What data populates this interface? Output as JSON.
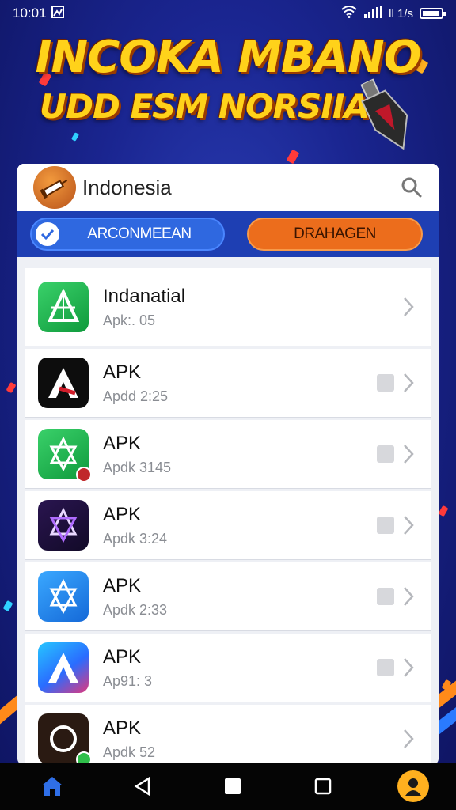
{
  "status_bar": {
    "time": "10:01",
    "notification_icon": "image-icon",
    "wifi_icon": "wifi-icon",
    "signal_icon": "signal-icon",
    "extra_text": "ll 1/s",
    "battery_icon": "battery-icon"
  },
  "banner": {
    "line1": "INCOKA MBANO",
    "line2": "UDD ESM NORSIIA"
  },
  "panel": {
    "logo_icon": "syringe-logo-icon",
    "title": "Indonesia",
    "search_icon": "search-icon"
  },
  "tabs": [
    {
      "label": "ARCONMEEAN",
      "icon": "check-circle-icon",
      "selected": true
    },
    {
      "label": "DRAHAGEN",
      "selected": false
    }
  ],
  "apps": [
    {
      "name": "Indanatial",
      "sub": "Apk:. 05",
      "icon": "green-a-icon"
    },
    {
      "name": "APK",
      "sub": "Apdd 2:25",
      "icon": "black-a-icon"
    },
    {
      "name": "APK",
      "sub": "Apdk 3145",
      "icon": "green-star-icon"
    },
    {
      "name": "APK",
      "sub": "Apdk 3:24",
      "icon": "purple-star-icon"
    },
    {
      "name": "APK",
      "sub": "Apdk 2:33",
      "icon": "blue-star-icon"
    },
    {
      "name": "APK",
      "sub": "Ap91: 3",
      "icon": "gradient-a-icon"
    },
    {
      "name": "APK",
      "sub": "Apdk 52",
      "icon": "circle-app-icon"
    }
  ],
  "nav": {
    "home_icon": "home-icon",
    "back_icon": "back-icon",
    "home_button_icon": "square-filled-icon",
    "recents_icon": "recents-icon",
    "profile_icon": "profile-icon"
  },
  "colors": {
    "tab_selected": "#2f68e0",
    "tab_other": "#ec6d1c",
    "banner_text": "#ffd21a"
  }
}
